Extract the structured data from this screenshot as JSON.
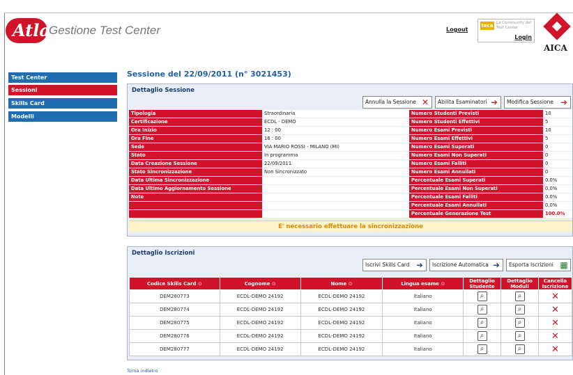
{
  "header": {
    "logo_mark": "Atlas",
    "app_title": "Gestione Test Center",
    "logout_label": "Logout",
    "community_badge": "teca",
    "community_tagline": "La Community dei Test Center",
    "login_label": "Login",
    "brand": "AICA"
  },
  "sidebar": {
    "items": [
      {
        "label": "Test Center"
      },
      {
        "label": "Sessioni"
      },
      {
        "label": "Skills Card"
      },
      {
        "label": "Modelli"
      }
    ]
  },
  "page_title": "Sessione del 22/09/2011 (n° 3021453)",
  "session_panel": {
    "title": "Dettaglio Sessione",
    "buttons": {
      "annulla": "Annulla la Sessione",
      "abilita": "Abilita Esaminatori",
      "modifica": "Modifica Sessione"
    },
    "rows": [
      {
        "l1": "Tipologia",
        "v1": "Straordinaria",
        "l2": "Numero Studenti Previsti",
        "v2": "10"
      },
      {
        "l1": "Certificazione",
        "v1": "ECDL - DEMO",
        "l2": "Numero Studenti Effettivi",
        "v2": "5"
      },
      {
        "l1": "Ora Inizio",
        "v1": "12 : 00",
        "l2": "Numero Esami Previsti",
        "v2": "10"
      },
      {
        "l1": "Ora Fine",
        "v1": "16 : 00",
        "l2": "Numero Esami Effettivi",
        "v2": "5"
      },
      {
        "l1": "Sede",
        "v1": "VIA MARIO ROSSI - MILANO (MI)",
        "l2": "Numero Esami Superati",
        "v2": "0"
      },
      {
        "l1": "Stato",
        "v1": "In programma",
        "l2": "Numero Esami Non Superati",
        "v2": "0"
      },
      {
        "l1": "Data Creazione Sessione",
        "v1": "22/09/2011",
        "l2": "Numero Esami Falliti",
        "v2": "0"
      },
      {
        "l1": "Stato Sincronizzazione",
        "v1": "Non Sincronizzato",
        "l2": "Numero Esami Annullati",
        "v2": "0"
      },
      {
        "l1": "Data Ultima Sincronizzazione",
        "v1": "",
        "l2": "Percentuale Esami Superati",
        "v2": "0.0%"
      },
      {
        "l1": "Data Ultimo Aggiornamento Sessione",
        "v1": "",
        "l2": "Percentuale Esami Non Superati",
        "v2": "0.0%"
      },
      {
        "l1": "Note",
        "v1": "",
        "l2": "Percentuale Esami Falliti",
        "v2": "0.0%"
      },
      {
        "l1": "",
        "v1": "",
        "l2": "Percentuale Esami Annullati",
        "v2": "0.0%"
      },
      {
        "l1": "",
        "v1": "",
        "l2": "Percentuale Generazione Test",
        "v2": "100.0%"
      }
    ],
    "sync_message": "E' necessario effettuare la sincronizzazione"
  },
  "enrollments_panel": {
    "title": "Dettaglio Iscrizioni",
    "buttons": {
      "iscrivi": "Iscrivi Skills Card",
      "automatica": "Iscrizione Automatica",
      "esporta": "Esporta Iscrizioni"
    },
    "columns": [
      "Codice Skills Card",
      "Cognome",
      "Nome",
      "Lingua esame",
      "Dettaglio Studente",
      "Dettaglio Moduli",
      "Cancella Iscrizione"
    ],
    "rows": [
      {
        "code": "DEM280773",
        "cognome": "ECDL-DEMO 24192",
        "nome": "ECDL-DEMO 24192",
        "lingua": "Italiano"
      },
      {
        "code": "DEM280774",
        "cognome": "ECDL-DEMO 24192",
        "nome": "ECDL-DEMO 24192",
        "lingua": "Italiano"
      },
      {
        "code": "DEM280775",
        "cognome": "ECDL-DEMO 24192",
        "nome": "ECDL-DEMO 24192",
        "lingua": "Italiano"
      },
      {
        "code": "DEM280776",
        "cognome": "ECDL-DEMO 24192",
        "nome": "ECDL-DEMO 24192",
        "lingua": "Italiano"
      },
      {
        "code": "DEM280777",
        "cognome": "ECDL-DEMO 24192",
        "nome": "ECDL-DEMO 24192",
        "lingua": "Italiano"
      }
    ]
  },
  "back_link": "Torna indietro",
  "icons": {
    "sort": "sort-icon",
    "zoom": "magnifier-icon",
    "delete": "delete-x-icon",
    "cancel": "cancel-x-icon",
    "enable": "user-arrow-icon",
    "edit": "edit-arrow-icon",
    "enroll": "users-arrow-icon",
    "export": "excel-export-icon"
  },
  "colors": {
    "accent_red": "#d2142a",
    "nav_blue": "#1f6cb0",
    "title_blue": "#1f5ea8",
    "warning_orange": "#e08a00"
  }
}
